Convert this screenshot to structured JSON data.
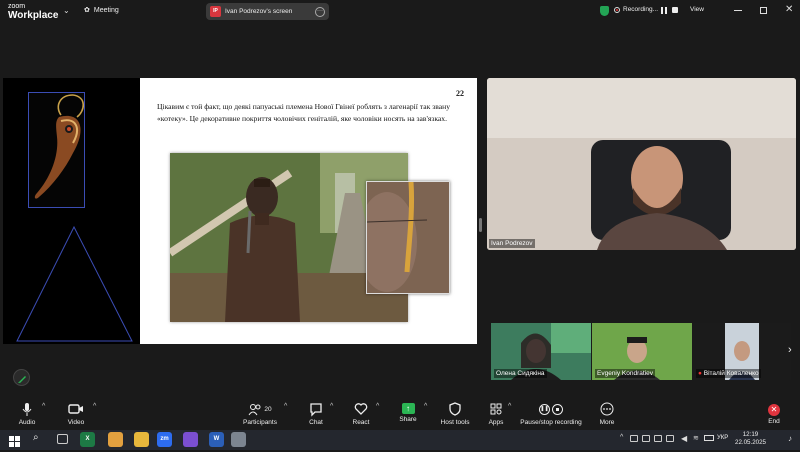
{
  "app": {
    "brand_small": "zoom",
    "brand_large": "Workplace",
    "meeting_label": "Meeting"
  },
  "share_pill": {
    "badge": "IP",
    "title": "Ivan Podrezov's screen"
  },
  "recording": {
    "label": "Recording..."
  },
  "view_label": "View",
  "slide": {
    "page_number": "22",
    "text": "Цікавим є той факт, що деякі папуаські племена Нової Гвінеї роблять з лагенарії так звану «котеку». Це декоративне покриття чоловічих геніталій, яке чоловіки носять на зав'язках."
  },
  "main_video": {
    "name": "Ivan Podrezov"
  },
  "gallery": [
    {
      "name": "Олена Сидякіна"
    },
    {
      "name": "Evgeniy Kondratiev"
    },
    {
      "name": "Віталій Коваленко"
    }
  ],
  "toolbar": {
    "audio": "Audio",
    "video": "Video",
    "participants": "Participants",
    "participants_count": "20",
    "chat": "Chat",
    "react": "React",
    "share": "Share",
    "host_tools": "Host tools",
    "apps": "Apps",
    "recording": "Pause/stop recording",
    "more": "More",
    "end": "End"
  },
  "taskbar": {
    "apps": [
      {
        "icon": "excel-icon",
        "label": "X",
        "color": "#1d7a45"
      },
      {
        "icon": "chrome-icon",
        "label": "",
        "color": "#e2a03f"
      },
      {
        "icon": "file-explorer-icon",
        "label": "",
        "color": "#e7b73c"
      },
      {
        "icon": "zoom-icon",
        "label": "zm",
        "color": "#2d6cf0"
      },
      {
        "icon": "viber-icon",
        "label": "",
        "color": "#7b4fd1"
      },
      {
        "icon": "word-icon",
        "label": "W",
        "color": "#2b5fb8"
      },
      {
        "icon": "photos-icon",
        "label": "",
        "color": "#7c8591"
      }
    ],
    "language": "УКР",
    "time": "12:19",
    "date": "22.05.2025"
  },
  "colors": {
    "accent": "#2bb554",
    "end": "#e0343e",
    "recording_dot": "#e33333"
  }
}
